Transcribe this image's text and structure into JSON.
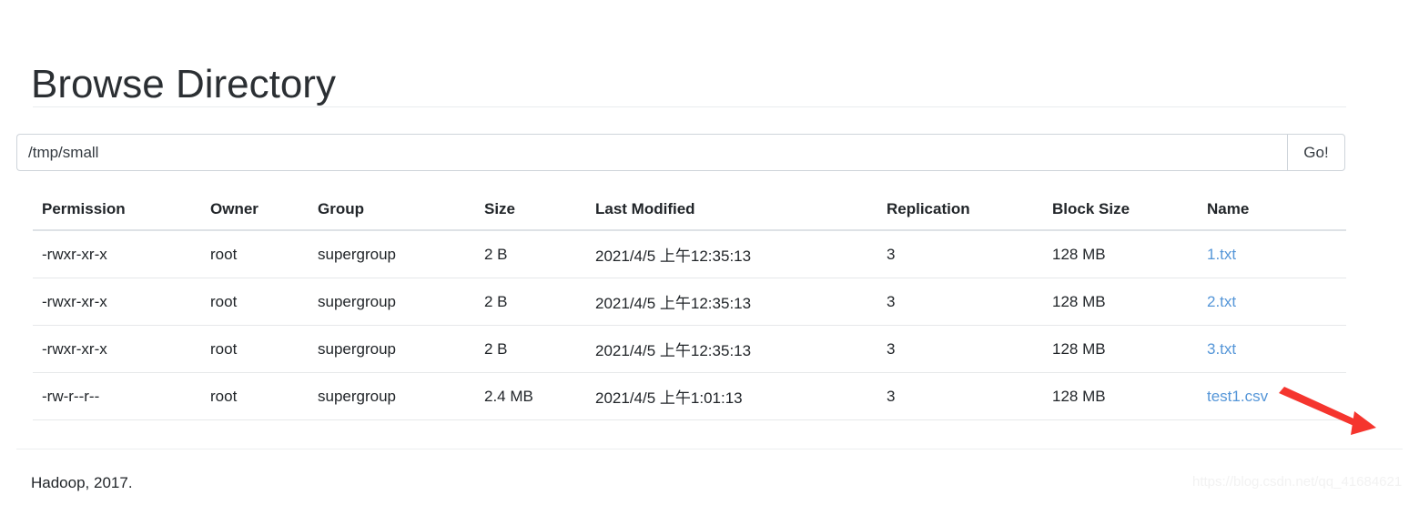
{
  "header": {
    "title": "Browse Directory"
  },
  "path_form": {
    "value": "/tmp/small",
    "placeholder": "/tmp/small",
    "submit_label": "Go!"
  },
  "table": {
    "columns": [
      "Permission",
      "Owner",
      "Group",
      "Size",
      "Last Modified",
      "Replication",
      "Block Size",
      "Name"
    ],
    "rows": [
      {
        "permission": "-rwxr-xr-x",
        "owner": "root",
        "group": "supergroup",
        "size": "2 B",
        "last_modified": "2021/4/5 上午12:35:13",
        "replication": "3",
        "block_size": "128 MB",
        "name": "1.txt"
      },
      {
        "permission": "-rwxr-xr-x",
        "owner": "root",
        "group": "supergroup",
        "size": "2 B",
        "last_modified": "2021/4/5 上午12:35:13",
        "replication": "3",
        "block_size": "128 MB",
        "name": "2.txt"
      },
      {
        "permission": "-rwxr-xr-x",
        "owner": "root",
        "group": "supergroup",
        "size": "2 B",
        "last_modified": "2021/4/5 上午12:35:13",
        "replication": "3",
        "block_size": "128 MB",
        "name": "3.txt"
      },
      {
        "permission": "-rw-r--r--",
        "owner": "root",
        "group": "supergroup",
        "size": "2.4 MB",
        "last_modified": "2021/4/5 上午1:01:13",
        "replication": "3",
        "block_size": "128 MB",
        "name": "test1.csv"
      }
    ]
  },
  "footer": {
    "text": "Hadoop, 2017."
  },
  "annotation": {
    "arrow_color": "#f5352e"
  },
  "watermark": {
    "text": "https://blog.csdn.net/qq_41684621"
  },
  "colors": {
    "link": "#5596d8",
    "text": "#212529",
    "border": "#ced4da",
    "accent_red": "#f5352e"
  }
}
